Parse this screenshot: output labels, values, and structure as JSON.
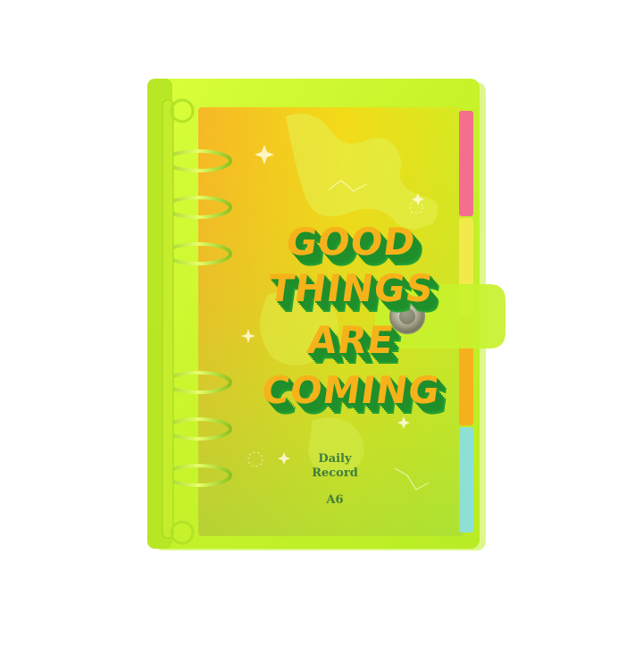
{
  "photo": {
    "cover_text": {
      "line1": "GOOD",
      "line2": "THINGS",
      "line3": "ARE",
      "line4": "COMING"
    },
    "label": {
      "line1": "Daily",
      "line2": "Record",
      "size": "A6"
    },
    "colors": {
      "cover_neon": "#c8f52a",
      "insert_yellow": "#f4d61a",
      "insert_orange": "#f59b2a",
      "title_gold": "#f6b21a",
      "title_shadow_green": "#1e8f2a",
      "tab_pink": "#f46e8e",
      "tab_yellow": "#f1ea4a",
      "tab_orange": "#f6b01d",
      "tab_blue": "#8fe0d4"
    }
  }
}
